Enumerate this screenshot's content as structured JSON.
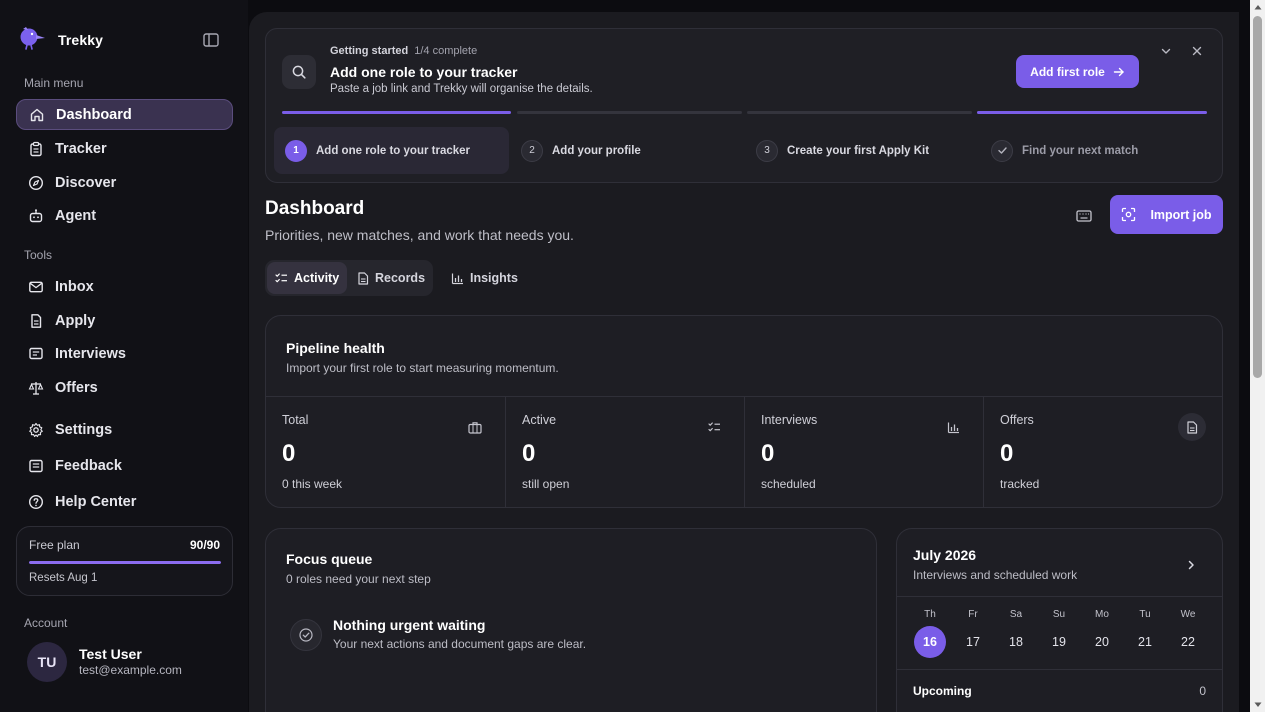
{
  "app": {
    "name": "Trekky"
  },
  "sidebar": {
    "main_label": "Main menu",
    "main_items": [
      {
        "label": "Dashboard",
        "icon": "home-icon",
        "active": true
      },
      {
        "label": "Tracker",
        "icon": "clipboard-icon"
      },
      {
        "label": "Discover",
        "icon": "compass-icon"
      },
      {
        "label": "Agent",
        "icon": "robot-icon"
      }
    ],
    "tools_label": "Tools",
    "tool_items": [
      {
        "label": "Inbox",
        "icon": "mail-icon"
      },
      {
        "label": "Apply",
        "icon": "file-icon"
      },
      {
        "label": "Interviews",
        "icon": "message-icon"
      },
      {
        "label": "Offers",
        "icon": "scale-icon"
      },
      {
        "label": "Settings",
        "icon": "gear-icon"
      },
      {
        "label": "Feedback",
        "icon": "feedback-icon"
      },
      {
        "label": "Help Center",
        "icon": "help-icon"
      }
    ],
    "plan": {
      "name": "Free plan",
      "count": "90/90",
      "fill_fraction": 1.0,
      "reset": "Resets Aug 1"
    },
    "account_label": "Account",
    "user": {
      "initials": "TU",
      "name": "Test User",
      "email": "test@example.com"
    }
  },
  "onboarding": {
    "kicker": "Getting started",
    "progress": "1/4 complete",
    "title": "Add one role to your tracker",
    "subtitle": "Paste a job link and Trekky will organise the details.",
    "cta": "Add first role",
    "steps": [
      {
        "num": "1",
        "label": "Add one role to your tracker",
        "state": "current"
      },
      {
        "num": "2",
        "label": "Add your profile",
        "state": "todo"
      },
      {
        "num": "3",
        "label": "Create your first Apply Kit",
        "state": "todo"
      },
      {
        "num": "",
        "label": "Find your next match",
        "state": "done"
      }
    ]
  },
  "page": {
    "title": "Dashboard",
    "subtitle": "Priorities, new matches, and work that needs you.",
    "import_label": "Import job"
  },
  "tabs": [
    {
      "label": "Activity",
      "icon": "checklist-icon",
      "active": true
    },
    {
      "label": "Records",
      "icon": "document-icon"
    },
    {
      "label": "Insights",
      "icon": "bar-chart-icon"
    }
  ],
  "pipeline": {
    "title": "Pipeline health",
    "subtitle": "Import your first role to start measuring momentum.",
    "stats": [
      {
        "label": "Total",
        "value": "0",
        "sub": "0 this week",
        "icon": "briefcase-icon"
      },
      {
        "label": "Active",
        "value": "0",
        "sub": "still open",
        "icon": "checklist-icon"
      },
      {
        "label": "Interviews",
        "value": "0",
        "sub": "scheduled",
        "icon": "bar-chart-icon"
      },
      {
        "label": "Offers",
        "value": "0",
        "sub": "tracked",
        "icon": "document-icon"
      }
    ]
  },
  "focus": {
    "title": "Focus queue",
    "subtitle": "0 roles need your next step",
    "empty_title": "Nothing urgent waiting",
    "empty_sub": "Your next actions and document gaps are clear."
  },
  "calendar": {
    "month": "July 2026",
    "subtitle": "Interviews and scheduled work",
    "days": [
      {
        "dow": "Th",
        "date": "16",
        "today": true
      },
      {
        "dow": "Fr",
        "date": "17"
      },
      {
        "dow": "Sa",
        "date": "18"
      },
      {
        "dow": "Su",
        "date": "19"
      },
      {
        "dow": "Mo",
        "date": "20"
      },
      {
        "dow": "Tu",
        "date": "21"
      },
      {
        "dow": "We",
        "date": "22"
      }
    ],
    "upcoming_label": "Upcoming",
    "upcoming_count": "0"
  },
  "colors": {
    "accent": "#7a5de8",
    "active_nav": "#3a3250",
    "background": "#1b1b20"
  }
}
